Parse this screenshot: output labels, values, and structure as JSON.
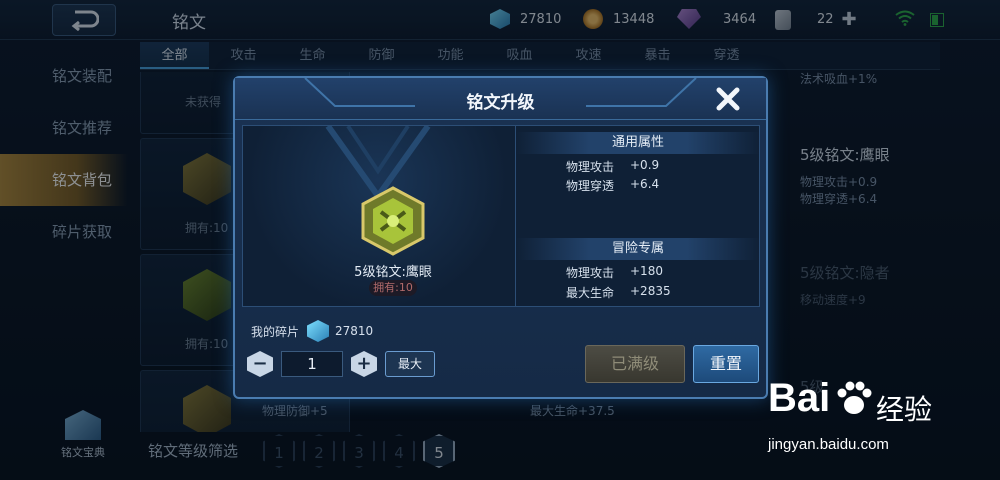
{
  "header": {
    "title": "铭文",
    "resources": [
      {
        "icon": "crystal-icon",
        "value": "27810"
      },
      {
        "icon": "gold-coin-icon",
        "value": "13448"
      },
      {
        "icon": "gem-icon",
        "value": "3464"
      },
      {
        "icon": "card-icon",
        "value": "22"
      }
    ]
  },
  "tabs": [
    "全部",
    "攻击",
    "生命",
    "防御",
    "功能",
    "吸血",
    "攻速",
    "暴击",
    "穿透"
  ],
  "sidebar": {
    "items": [
      "铭文装配",
      "铭文推荐",
      "铭文背包",
      "碎片获取"
    ],
    "active_index": 2,
    "book_label": "铭文宝典"
  },
  "background": {
    "unowned": "未获得",
    "own_label": "拥有:10",
    "right_top_stat": "法术吸血+1%",
    "eagle_title": "5级铭文:鹰眼",
    "eagle_stats": [
      "物理攻击+0.9",
      "物理穿透+6.4"
    ],
    "dim_title": "5级铭文:隐者",
    "dim_stat": "移动速度+9",
    "bottom_stat_1": "物理防御+5",
    "bottom_stat_2": "最大生命+37.5",
    "dim_title_2": "5级",
    "filter_label": "铭文等级筛选",
    "levels": [
      "1",
      "2",
      "3",
      "4",
      "5"
    ],
    "active_level": "5"
  },
  "modal": {
    "title": "铭文升级",
    "rune_name": "5级铭文:鹰眼",
    "rune_owned": "拥有:10",
    "general": {
      "heading": "通用属性",
      "stats": [
        {
          "name": "物理攻击",
          "value": "+0.9"
        },
        {
          "name": "物理穿透",
          "value": "+6.4"
        }
      ]
    },
    "adventure": {
      "heading": "冒险专属",
      "stats": [
        {
          "name": "物理攻击",
          "value": "+180"
        },
        {
          "name": "最大生命",
          "value": "+2835"
        }
      ]
    },
    "fragments_label": "我的碎片",
    "fragments_value": "27810",
    "quantity": "1",
    "max_label": "最大",
    "maxed_label": "已满级",
    "reset_label": "重置"
  },
  "watermark": {
    "brand_left": "Bai",
    "brand_right": "经验",
    "url": "jingyan.baidu.com"
  },
  "colors": {
    "accent": "#4aa3e0",
    "sidebar_active": "#b08a3c",
    "modal_border": "#4a7cb0"
  }
}
